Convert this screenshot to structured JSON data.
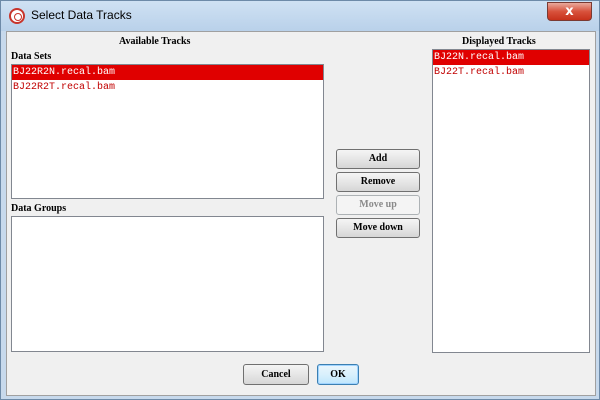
{
  "window": {
    "title": "Select Data Tracks",
    "close_glyph": "x"
  },
  "available": {
    "heading": "Available Tracks",
    "data_sets_label": "Data Sets",
    "data_sets": [
      {
        "label": "BJ22R2N.recal.bam",
        "selected": true
      },
      {
        "label": "BJ22R2T.recal.bam",
        "selected": false
      }
    ],
    "data_groups_label": "Data Groups",
    "data_groups": []
  },
  "displayed": {
    "heading": "Displayed Tracks",
    "items": [
      {
        "label": "BJ22N.recal.bam",
        "selected": true
      },
      {
        "label": "BJ22T.recal.bam",
        "selected": false
      }
    ]
  },
  "actions": {
    "add": "Add",
    "remove": "Remove",
    "move_up": "Move up",
    "move_down": "Move down"
  },
  "footer": {
    "cancel": "Cancel",
    "ok": "OK"
  },
  "colors": {
    "selection": "#e00000",
    "item_text": "#c00000"
  }
}
